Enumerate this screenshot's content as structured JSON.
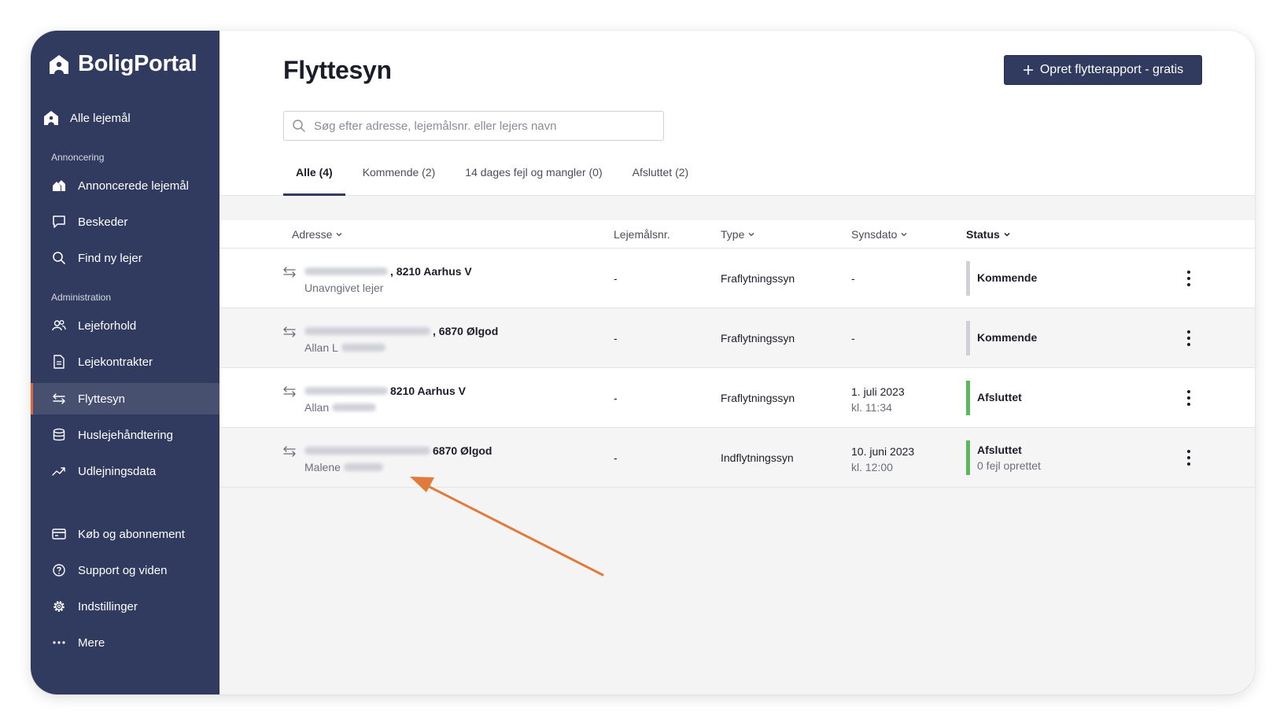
{
  "brand": {
    "name": "BoligPortal"
  },
  "sidebar": {
    "home": {
      "label": "Alle lejemål",
      "icon": "house-icon"
    },
    "sections": [
      {
        "title": "Annoncering"
      },
      {
        "title": "Administration"
      }
    ],
    "items": [
      {
        "label": "Annoncerede lejemål",
        "icon": "houses-icon"
      },
      {
        "label": "Beskeder",
        "icon": "chat-icon"
      },
      {
        "label": "Find ny lejer",
        "icon": "search-icon"
      },
      {
        "label": "Lejeforhold",
        "icon": "users-icon"
      },
      {
        "label": "Lejekontrakter",
        "icon": "document-icon"
      },
      {
        "label": "Flyttesyn",
        "icon": "move-arrows-icon",
        "active": true
      },
      {
        "label": "Huslejehåndtering",
        "icon": "database-icon"
      },
      {
        "label": "Udlejningsdata",
        "icon": "trend-icon"
      },
      {
        "label": "Køb og abonnement",
        "icon": "card-icon"
      },
      {
        "label": "Support og viden",
        "icon": "question-icon"
      },
      {
        "label": "Indstillinger",
        "icon": "gear-icon"
      },
      {
        "label": "Mere",
        "icon": "more-dots-icon"
      }
    ]
  },
  "main": {
    "title": "Flyttesyn",
    "create_button": "Opret flytterapport - gratis",
    "search_placeholder": "Søg efter adresse, lejemålsnr. eller lejers navn",
    "tabs": [
      {
        "label": "Alle (4)",
        "active": true
      },
      {
        "label": "Kommende (2)"
      },
      {
        "label": "14 dages fejl og mangler (0)"
      },
      {
        "label": "Afsluttet (2)"
      }
    ],
    "columns": {
      "address": "Adresse",
      "lease_no": "Lejemålsnr.",
      "type": "Type",
      "date": "Synsdato",
      "status": "Status"
    },
    "rows": [
      {
        "address_suffix": ", 8210 Aarhus V",
        "tenant": "Unavngivet lejer",
        "lease_no": "-",
        "type": "Fraflytningssyn",
        "date": "-",
        "time": "",
        "status": "Kommende",
        "status_sub": "",
        "status_color": "#d0d1d6"
      },
      {
        "address_suffix": ", 6870 Ølgod",
        "tenant": "Allan L",
        "lease_no": "-",
        "type": "Fraflytningssyn",
        "date": "-",
        "time": "",
        "status": "Kommende",
        "status_sub": "",
        "status_color": "#d0d1d6"
      },
      {
        "address_suffix": " 8210 Aarhus V",
        "tenant": "Allan",
        "lease_no": "-",
        "type": "Fraflytningssyn",
        "date": "1. juli 2023",
        "time": "kl. 11:34",
        "status": "Afsluttet",
        "status_sub": "",
        "status_color": "#5cb85c"
      },
      {
        "address_suffix": " 6870 Ølgod",
        "tenant": "Malene",
        "lease_no": "-",
        "type": "Indflytningssyn",
        "date": "10. juni 2023",
        "time": "kl. 12:00",
        "status": "Afsluttet",
        "status_sub": "0 fejl oprettet",
        "status_color": "#5cb85c"
      }
    ]
  },
  "colors": {
    "sidebar": "#313b60",
    "active_accent": "#e0643a",
    "completed": "#5cb85c",
    "pending": "#d0d1d6",
    "annotation_arrow": "#e07b3c"
  }
}
